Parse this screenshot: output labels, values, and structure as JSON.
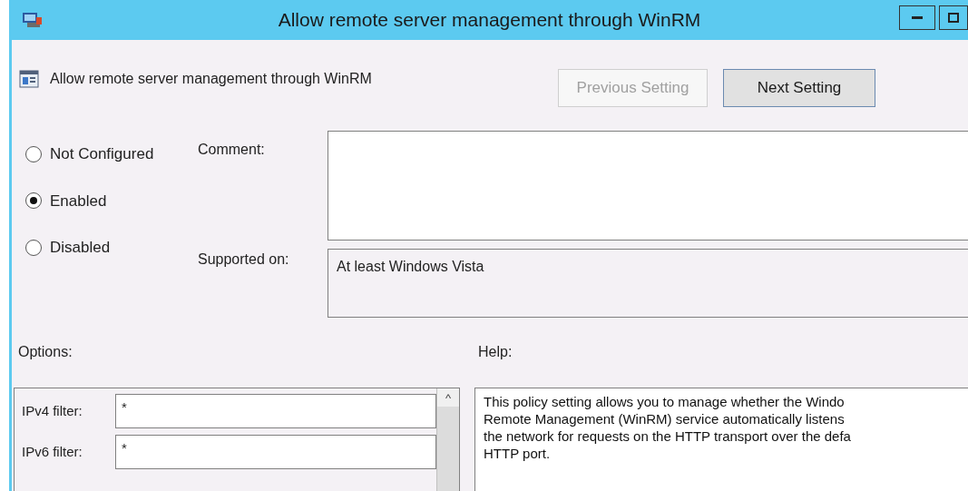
{
  "window": {
    "title": "Allow remote server management through WinRM"
  },
  "header": {
    "title": "Allow remote server management through WinRM"
  },
  "buttons": [
    {
      "label": "Previous Setting",
      "disabled": true
    },
    {
      "label": "Next Setting",
      "disabled": false
    }
  ],
  "state_options": [
    {
      "label": "Not Configured",
      "selected": false
    },
    {
      "label": "Enabled",
      "selected": true
    },
    {
      "label": "Disabled",
      "selected": false
    }
  ],
  "comment": {
    "label": "Comment:"
  },
  "supported_on": {
    "label": "Supported on:",
    "value": "At least Windows Vista"
  },
  "options": {
    "label": "Options:",
    "fields": [
      {
        "label": "IPv4 filter:",
        "value": "*"
      },
      {
        "label": "IPv6 filter:",
        "value": "*"
      }
    ],
    "scroll_up": "^"
  },
  "help": {
    "label": "Help:",
    "lines": [
      "This policy setting allows you to manage whether the Windo",
      "Remote Management (WinRM) service automatically listens",
      "the network for requests on the HTTP transport over the defa",
      "HTTP port."
    ]
  }
}
